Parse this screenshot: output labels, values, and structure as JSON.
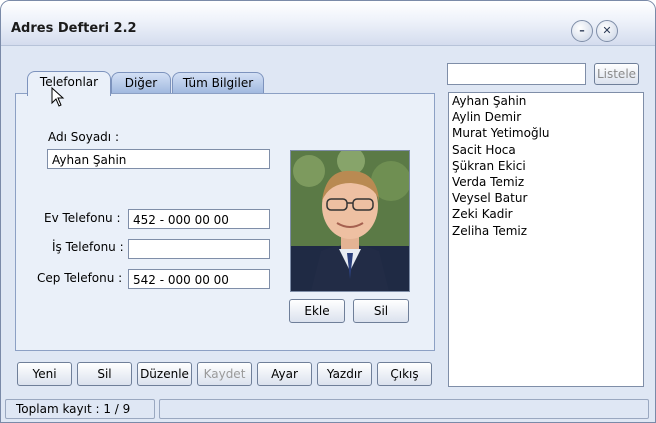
{
  "window": {
    "title": "Adres Defteri 2.2",
    "minimize_symbol": "–",
    "close_symbol": "✕"
  },
  "tabs": [
    {
      "label": "Telefonlar",
      "active": true
    },
    {
      "label": "Diğer",
      "active": false
    },
    {
      "label": "Tüm Bilgiler",
      "active": false
    }
  ],
  "form": {
    "name_label": "Adı Soyadı :",
    "name_value": "Ayhan Şahin",
    "home_phone_label": "Ev Telefonu :",
    "home_phone_value": "452 - 000 00 00",
    "work_phone_label": "İş Telefonu :",
    "work_phone_value": "",
    "mobile_phone_label": "Cep Telefonu :",
    "mobile_phone_value": "542 - 000 00 00"
  },
  "photo_buttons": {
    "add": "Ekle",
    "delete": "Sil"
  },
  "toolbar": {
    "new": "Yeni",
    "delete": "Sil",
    "edit": "Düzenle",
    "save": "Kaydet",
    "settings": "Ayar",
    "print": "Yazdır",
    "exit": "Çıkış"
  },
  "search": {
    "value": "",
    "list_button": "Listele"
  },
  "contacts": [
    "Ayhan Şahin",
    "Aylin Demir",
    "Murat Yetimoğlu",
    "Sacit Hoca",
    "Şükran Ekici",
    "Verda Temiz",
    "Veysel Batur",
    "Zeki Kadir",
    "Zeliha Temiz"
  ],
  "status": {
    "record_count": "Toplam kayıt : 1 / 9",
    "extra": ""
  },
  "colors": {
    "window_bg": "#dfe7f4",
    "panel_bg": "#eaf0f9",
    "tab_inactive": "#a9bfe2",
    "border": "#7f8ea8"
  }
}
